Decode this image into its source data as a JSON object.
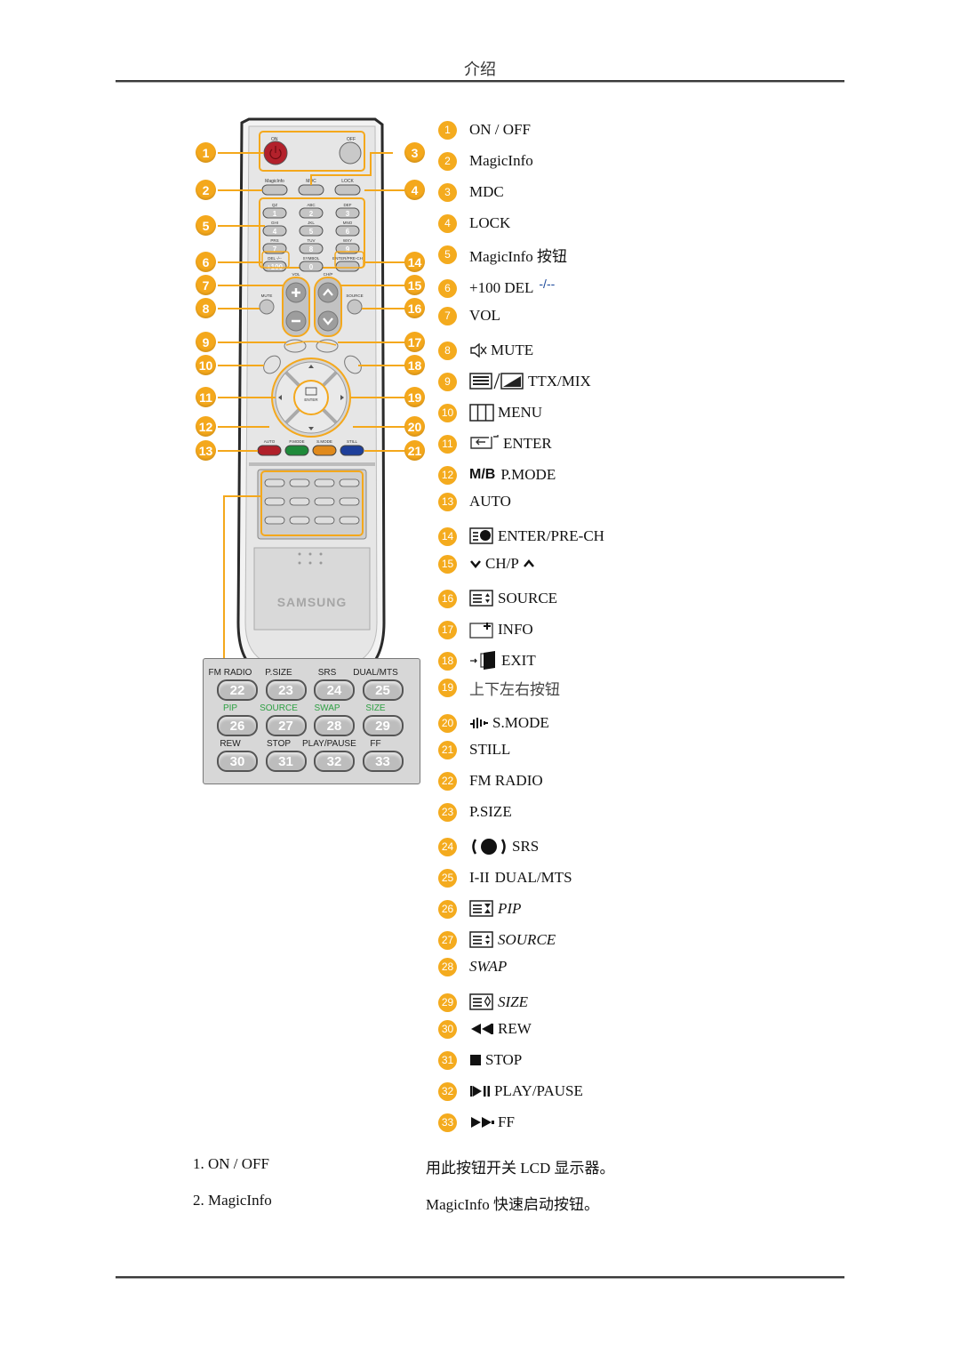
{
  "header": {
    "title": "介绍"
  },
  "remote": {
    "top_labels": {
      "on": "ON",
      "off": "OFF",
      "magicinfo": "MagicInfo",
      "mdc": "MDC",
      "lock": "LOCK"
    },
    "number_keys": [
      {
        "letters": "QZ",
        "digit": "1"
      },
      {
        "letters": "ABC",
        "digit": "2"
      },
      {
        "letters": "DEF",
        "digit": "3"
      },
      {
        "letters": "GHI",
        "digit": "4"
      },
      {
        "letters": "JKL",
        "digit": "5"
      },
      {
        "letters": "MNO",
        "digit": "6"
      },
      {
        "letters": "PRS",
        "digit": "7"
      },
      {
        "letters": "TUV",
        "digit": "8"
      },
      {
        "letters": "WXY",
        "digit": "9"
      },
      {
        "letters": "DEL -/--",
        "digit": "+100"
      },
      {
        "letters": "SYMBOL",
        "digit": "0"
      },
      {
        "letters": "ENTER/PRE-CH",
        "digit": ""
      }
    ],
    "vol_label": "VOL",
    "ch_label": "CH/P",
    "mute_label": "MUTE",
    "source_label": "SOURCE",
    "ttx_label": "TTX/MIX",
    "info_label": "INFO",
    "menu_label": "MENU",
    "exit_label": "EXIT",
    "enter_label": "ENTER",
    "color_keys": [
      {
        "label": "AUTO",
        "color": "#b0202a"
      },
      {
        "label": "P.MODE",
        "color": "#1f8a3a",
        "glyph": "M/B"
      },
      {
        "label": "S.MODE",
        "color": "#e08a1c"
      },
      {
        "label": "STILL",
        "color": "#1e3f9a"
      }
    ],
    "brand": "SAMSUNG",
    "badge_color": "#f4a81c",
    "left_badges": [
      "1",
      "2",
      "5",
      "6",
      "7",
      "8",
      "9",
      "10",
      "11",
      "12",
      "13"
    ],
    "right_badges": [
      "3",
      "4",
      "14",
      "15",
      "16",
      "17",
      "18",
      "19",
      "20",
      "21"
    ]
  },
  "key_grid": {
    "rows": [
      {
        "labels": [
          "FM RADIO",
          "P.SIZE",
          "SRS",
          "DUAL/MTS"
        ],
        "keys": [
          "22",
          "23",
          "24",
          "25"
        ],
        "green": false
      },
      {
        "labels": [
          "PIP",
          "SOURCE",
          "SWAP",
          "SIZE"
        ],
        "keys": [
          "26",
          "27",
          "28",
          "29"
        ],
        "green": true
      },
      {
        "labels": [
          "REW",
          "STOP",
          "PLAY/PAUSE",
          "FF"
        ],
        "keys": [
          "30",
          "31",
          "32",
          "33"
        ],
        "green": false
      }
    ]
  },
  "legend": [
    {
      "num": "1",
      "label": "ON / OFF"
    },
    {
      "num": "2",
      "label": "MagicInfo"
    },
    {
      "num": "3",
      "label": "MDC"
    },
    {
      "num": "4",
      "label": "LOCK"
    },
    {
      "num": "5",
      "label": "MagicInfo 按钮"
    },
    {
      "num": "6",
      "label": "+100 DEL",
      "suffix": "-/--"
    },
    {
      "num": "7",
      "label": "VOL"
    },
    {
      "num": "8",
      "label": "MUTE",
      "icon": "mute-icon"
    },
    {
      "num": "9",
      "label": "TTX/MIX",
      "icon": "ttx-mix-icon"
    },
    {
      "num": "10",
      "label": "MENU",
      "icon": "menu-icon"
    },
    {
      "num": "11",
      "label": "ENTER",
      "icon": "enter-icon"
    },
    {
      "num": "12",
      "label": "P.MODE",
      "icon": "mb-icon",
      "icon_text": "M/B"
    },
    {
      "num": "13",
      "label": "AUTO"
    },
    {
      "num": "14",
      "label": "ENTER/PRE-CH",
      "icon": "pre-ch-icon"
    },
    {
      "num": "15",
      "label": "CH/P",
      "icon": "chevron-down-icon",
      "icon_after": "chevron-up-icon"
    },
    {
      "num": "16",
      "label": "SOURCE",
      "icon": "source-icon"
    },
    {
      "num": "17",
      "label": "INFO",
      "icon": "info-icon"
    },
    {
      "num": "18",
      "label": "EXIT",
      "icon": "exit-icon"
    },
    {
      "num": "19",
      "label": "上下左右按钮"
    },
    {
      "num": "20",
      "label": "S.MODE",
      "icon": "s-mode-icon"
    },
    {
      "num": "21",
      "label": "STILL"
    },
    {
      "num": "22",
      "label": "FM RADIO"
    },
    {
      "num": "23",
      "label": "P.SIZE"
    },
    {
      "num": "24",
      "label": "SRS",
      "icon": "srs-icon"
    },
    {
      "num": "25",
      "label": "DUAL/MTS",
      "icon": "dual-icon",
      "icon_text": "I-II"
    },
    {
      "num": "26",
      "label": "PIP",
      "icon": "pip-icon",
      "italic": true
    },
    {
      "num": "27",
      "label": "SOURCE",
      "icon": "source-icon",
      "italic": true
    },
    {
      "num": "28",
      "label": "SWAP",
      "italic": true
    },
    {
      "num": "29",
      "label": "SIZE",
      "icon": "size-icon",
      "italic": true
    },
    {
      "num": "30",
      "label": "REW",
      "icon": "rewind-icon"
    },
    {
      "num": "31",
      "label": "STOP",
      "icon": "stop-icon"
    },
    {
      "num": "32",
      "label": "PLAY/PAUSE",
      "icon": "play-pause-icon"
    },
    {
      "num": "33",
      "label": "FF",
      "icon": "fast-forward-icon"
    }
  ],
  "descriptions": [
    {
      "name": "1. ON / OFF",
      "text": "用此按钮开关 LCD 显示器。"
    },
    {
      "name": "2. MagicInfo",
      "text": "MagicInfo 快速启动按钮。"
    }
  ]
}
